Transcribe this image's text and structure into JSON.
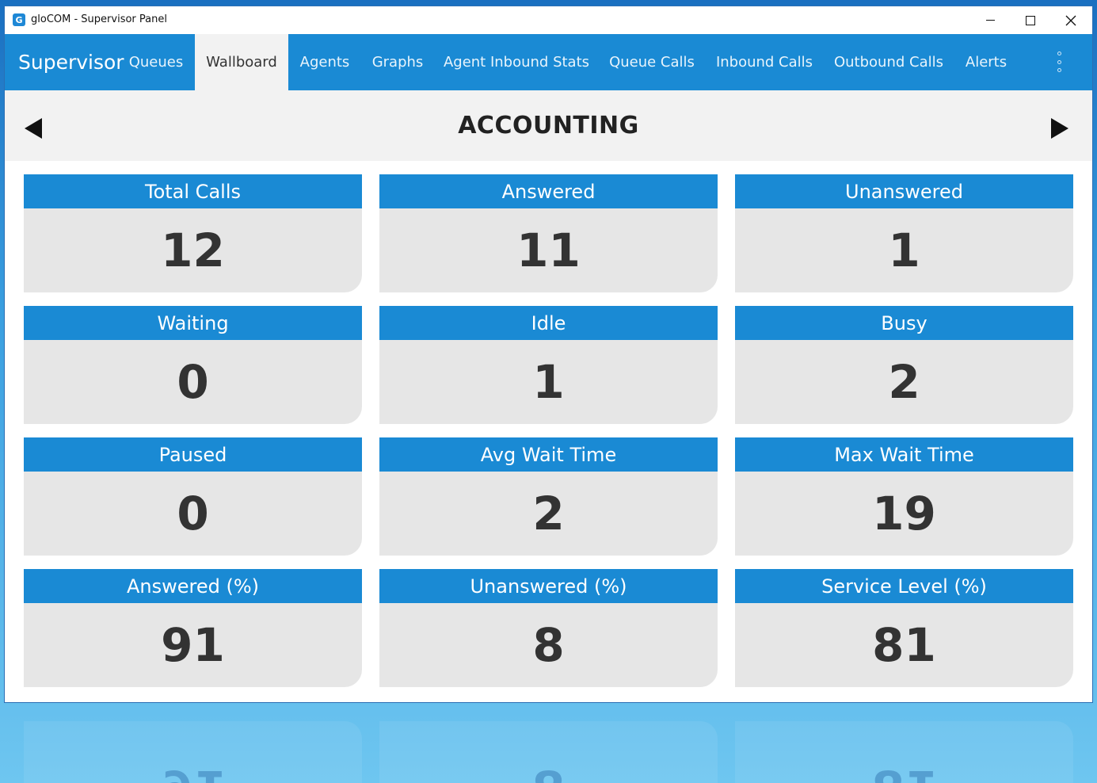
{
  "window": {
    "title": "gloCOM - Supervisor Panel",
    "app_icon": "G"
  },
  "nav": {
    "brand": "Supervisor",
    "items": [
      {
        "label": "Queues",
        "active": false
      },
      {
        "label": "Wallboard",
        "active": true
      },
      {
        "label": "Agents",
        "active": false
      },
      {
        "label": "Graphs",
        "active": false
      },
      {
        "label": "Agent Inbound Stats",
        "active": false
      },
      {
        "label": "Queue Calls",
        "active": false
      },
      {
        "label": "Inbound Calls",
        "active": false
      },
      {
        "label": "Outbound Calls",
        "active": false
      },
      {
        "label": "Alerts",
        "active": false
      }
    ]
  },
  "queue": {
    "name": "ACCOUNTING"
  },
  "tiles": [
    {
      "label": "Total Calls",
      "value": "12"
    },
    {
      "label": "Answered",
      "value": "11"
    },
    {
      "label": "Unanswered",
      "value": "1"
    },
    {
      "label": "Waiting",
      "value": "0"
    },
    {
      "label": "Idle",
      "value": "1"
    },
    {
      "label": "Busy",
      "value": "2"
    },
    {
      "label": "Paused",
      "value": "0"
    },
    {
      "label": "Avg Wait Time",
      "value": "2"
    },
    {
      "label": "Max Wait Time",
      "value": "19"
    },
    {
      "label": "Answered (%)",
      "value": "91"
    },
    {
      "label": "Unanswered (%)",
      "value": "8"
    },
    {
      "label": "Service Level (%)",
      "value": "81"
    }
  ],
  "colors": {
    "accent": "#1a8ad4",
    "tile_body": "#e6e6e6",
    "header_bg": "#f2f2f2"
  }
}
